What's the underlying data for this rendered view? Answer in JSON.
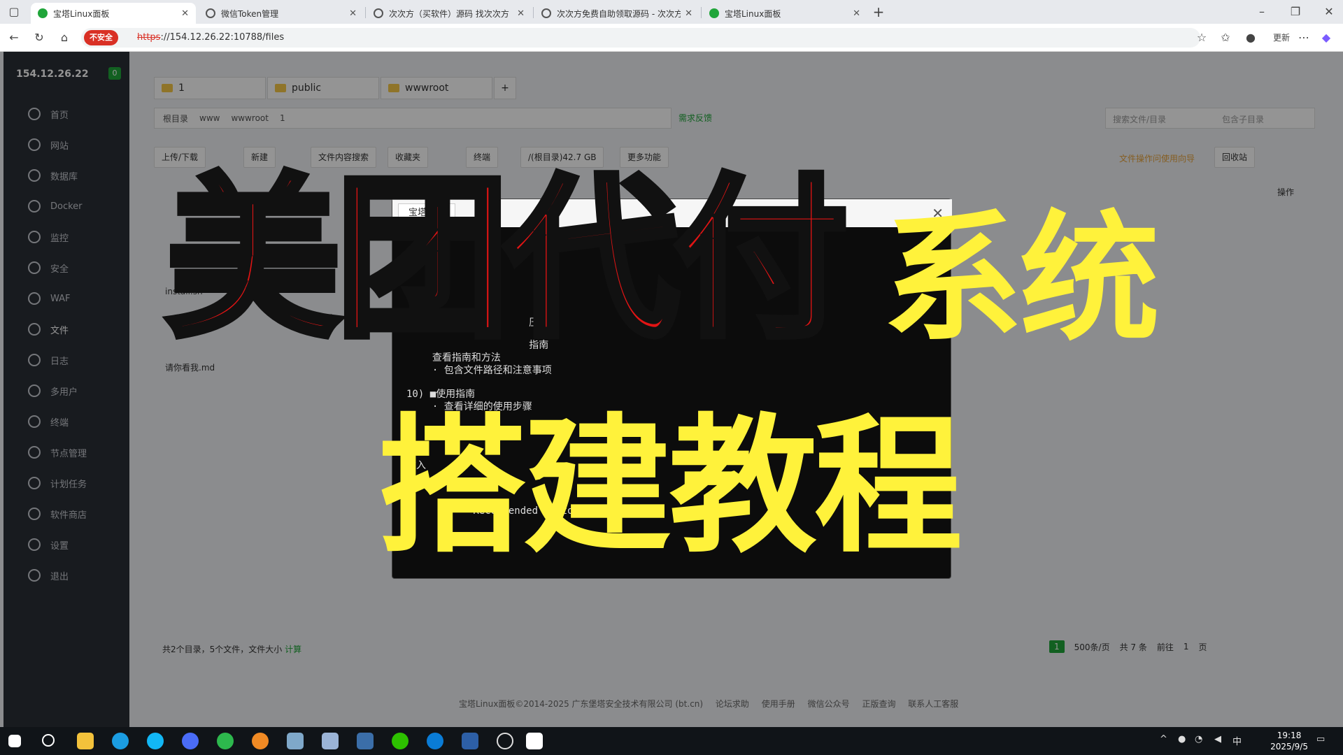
{
  "browser": {
    "tabs": [
      {
        "label": "宝塔Linux面板",
        "active": true
      },
      {
        "label": "微信Token管理",
        "active": false
      },
      {
        "label": "次次方（买软件）源码 找次次方",
        "active": false
      },
      {
        "label": "次次方免费自助领取源码 - 次次方",
        "active": false
      },
      {
        "label": "宝塔Linux面板",
        "active": false
      }
    ],
    "new_tab": "+",
    "insecure_label": "不安全",
    "url_scheme": "https",
    "url_rest": "://154.12.26.22:10788/files",
    "update_label": "更新"
  },
  "panel": {
    "server_ip": "154.12.26.22",
    "badge": "0",
    "sidebar": [
      {
        "label": "首页"
      },
      {
        "label": "网站"
      },
      {
        "label": "数据库"
      },
      {
        "label": "Docker"
      },
      {
        "label": "监控"
      },
      {
        "label": "安全"
      },
      {
        "label": "WAF"
      },
      {
        "label": "文件"
      },
      {
        "label": "日志"
      },
      {
        "label": "多用户"
      },
      {
        "label": "终端"
      },
      {
        "label": "节点管理"
      },
      {
        "label": "计划任务"
      },
      {
        "label": "软件商店"
      },
      {
        "label": "设置"
      },
      {
        "label": "退出"
      }
    ],
    "file_tabs": [
      "1",
      "public",
      "wwwroot"
    ],
    "breadcrumb": [
      "根目录",
      "www",
      "wwwroot",
      "1"
    ],
    "feedback": "需求反馈",
    "search_placeholder": "搜索文件/目录",
    "include_sub": "包含子目录",
    "toolbar": {
      "upload": "上传/下载",
      "new": "新建",
      "content_search": "文件内容搜索",
      "favorites": "收藏夹",
      "terminal": "终端",
      "disk": "/(根目录)42.7 GB",
      "more": "更多功能",
      "tip": "文件操作问使用向导",
      "recycle": "回收站"
    },
    "table_action_header": "操作",
    "files": [
      "install.sh",
      "请你看我.md"
    ],
    "summary": "共2个目录，5个文件，文件大小",
    "calc": "计算",
    "pager": {
      "page": "1",
      "per_page": "500条/页",
      "total": "共 7 条",
      "goto": "前往",
      "goto_page": "1",
      "page_unit": "页"
    },
    "copyright": "宝塔Linux面板©2014-2025 广东堡塔安全技术有限公司 (bt.cn)",
    "footer_links": [
      "论坛求助",
      "使用手册",
      "微信公众号",
      "正版查询",
      "联系人工客服"
    ]
  },
  "modal": {
    "title": "宝塔终端",
    "lines": [
      "   压缩",
      "   指南",
      "  查看指南和方法",
      "  · 包含文件路径和注意事项",
      "10) ■使用指南",
      "  · 查看详细的使用步骤",
      "输入",
      "   Recommended protocol disabled."
    ]
  },
  "overlay": {
    "title_red": "美团代付",
    "title_yellow_1": "系统",
    "title_yellow_2": "搭建教程"
  },
  "taskbar": {
    "time": "19:18",
    "date": "2025/9/5",
    "ime": "中"
  },
  "colors": {
    "brand_green": "#20a53a",
    "overlay_red": "#e21414",
    "overlay_yellow": "#fff23b"
  }
}
